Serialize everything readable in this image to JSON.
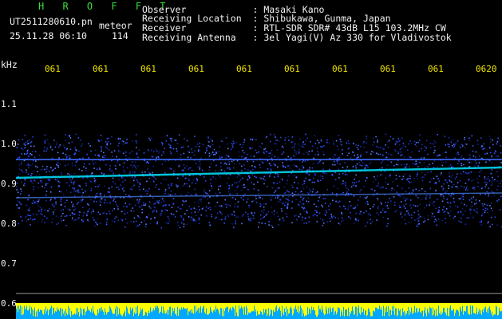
{
  "header": {
    "title": "H R O F F T",
    "file_name": "UT2511280610.pn",
    "meteor_label": "meteor",
    "date_time": "25.11.28 06:10",
    "meteor_count": "114"
  },
  "station_info": {
    "observer": "Observer            : Masaki Kano",
    "location": "Receiving Location  : Shibukawa, Gunma, Japan",
    "receiver": "Receiver            : RTL-SDR SDR# 43dB L15 103.2MHz CW",
    "antenna": "Receiving Antenna   : 3el Yagi(V) Az 330 for Vladivostok"
  },
  "axis": {
    "unit": "kHz",
    "time_ticks": [
      "061",
      "061",
      "061",
      "061",
      "061",
      "061",
      "061",
      "061",
      "061",
      "0620"
    ],
    "freq_labels": [
      "1.1",
      "1.0",
      "0.9",
      "0.8",
      "0.7",
      "0.6"
    ]
  },
  "colors": {
    "text_green": "#3adf3a",
    "text_yellow": "#f2e600",
    "text_white": "#f2f2f2",
    "noise_blue": "#1e3cff",
    "signal_cyan": "#00e5ff",
    "strip_yellow": "#ffff00"
  }
}
